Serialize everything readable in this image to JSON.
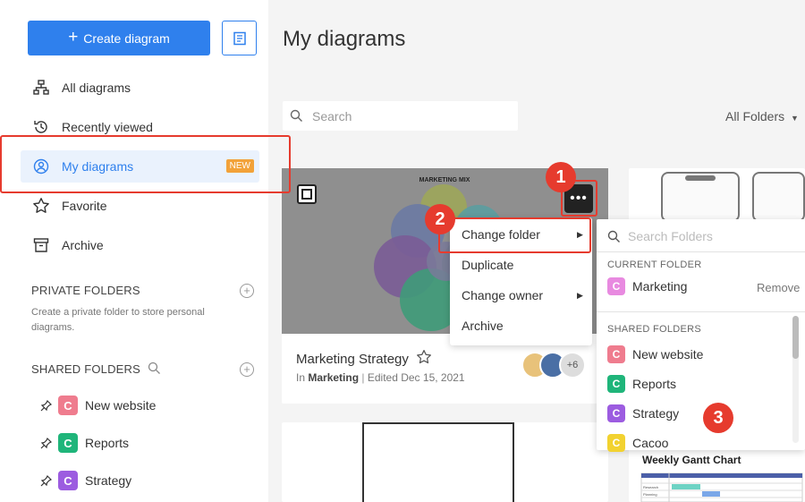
{
  "sidebar": {
    "create_label": "Create diagram",
    "nav": [
      {
        "label": "All diagrams",
        "icon": "sitemap-icon"
      },
      {
        "label": "Recently viewed",
        "icon": "history-icon"
      },
      {
        "label": "My diagrams",
        "icon": "user-circle-icon",
        "badge": "NEW"
      },
      {
        "label": "Favorite",
        "icon": "star-icon"
      },
      {
        "label": "Archive",
        "icon": "archive-icon"
      }
    ],
    "private_folders_title": "PRIVATE FOLDERS",
    "private_folders_desc": "Create a private folder to store personal diagrams.",
    "shared_folders_title": "SHARED FOLDERS",
    "shared_folders": [
      {
        "label": "New website",
        "color": "#ef7c8e"
      },
      {
        "label": "Reports",
        "color": "#1fb57a"
      },
      {
        "label": "Strategy",
        "color": "#9c5ce0"
      }
    ]
  },
  "main": {
    "title": "My diagrams",
    "search_placeholder": "Search",
    "folder_filter": "All Folders",
    "card": {
      "thumb_title": "MARKETING MIX",
      "name": "Marketing Strategy",
      "meta_prefix": "In",
      "meta_folder": "Marketing",
      "meta_edited": "Edited Dec 15, 2021",
      "extra_count": "+6"
    },
    "gantt_title": "Weekly Gantt Chart",
    "gantt_labels": [
      "Research",
      "Planning"
    ]
  },
  "context_menu": {
    "items": [
      {
        "label": "Change folder",
        "submenu": true
      },
      {
        "label": "Duplicate",
        "submenu": false
      },
      {
        "label": "Change owner",
        "submenu": true
      },
      {
        "label": "Archive",
        "submenu": false
      }
    ]
  },
  "folder_panel": {
    "search_placeholder": "Search Folders",
    "current_title": "CURRENT FOLDER",
    "current_folder": {
      "label": "Marketing",
      "color": "#e88ae0"
    },
    "remove_label": "Remove",
    "shared_title": "SHARED FOLDERS",
    "shared": [
      {
        "label": "New website",
        "color": "#ef7c8e"
      },
      {
        "label": "Reports",
        "color": "#1fb57a"
      },
      {
        "label": "Strategy",
        "color": "#9c5ce0"
      },
      {
        "label": "Cacoo",
        "color": "#f2d230"
      }
    ]
  },
  "callouts": [
    "1",
    "2",
    "3"
  ],
  "colors": {
    "accent": "#2f80ed",
    "callout": "#e63b2e",
    "badge": "#f2a23a"
  }
}
